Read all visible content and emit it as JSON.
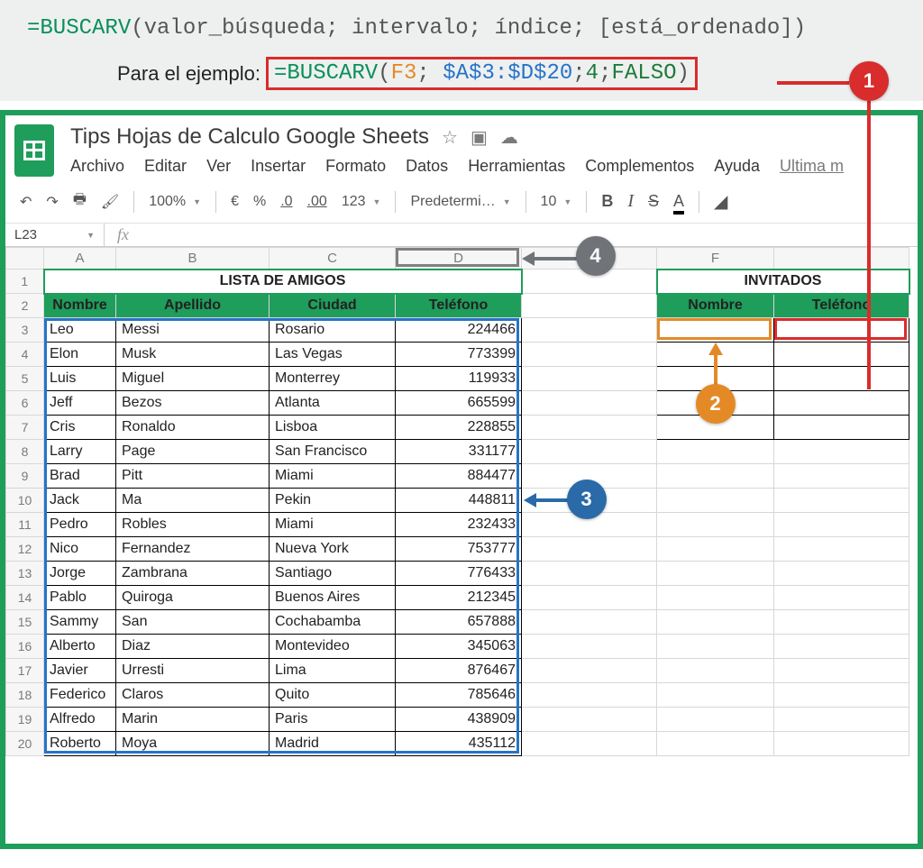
{
  "formula": {
    "syntax_func": "=BUSCARV",
    "syntax_args": "(valor_búsqueda; intervalo; índice; [está_ordenado])",
    "example_label": "Para el ejemplo:",
    "ex_func": "=BUSCARV",
    "ex_open": "(",
    "ex_ref": "F3",
    "ex_sep": ";",
    "ex_range": " $A$3:$D$20",
    "ex_idx": "4",
    "ex_bool": "FALSO",
    "ex_close": ")"
  },
  "doc": {
    "title": "Tips Hojas de Calculo Google Sheets",
    "last_mod": "Ultima m"
  },
  "menus": [
    "Archivo",
    "Editar",
    "Ver",
    "Insertar",
    "Formato",
    "Datos",
    "Herramientas",
    "Complementos",
    "Ayuda"
  ],
  "toolbar": {
    "zoom": "100%",
    "currency": "€",
    "percent": "%",
    "dec_dec": ".0",
    "inc_dec": ".00",
    "fmt123": "123",
    "font": "Predetermi…",
    "fontsize": "10",
    "bold": "B",
    "italic": "I",
    "strike": "S",
    "textcolor": "A"
  },
  "namebox": "L23",
  "colHeaders": [
    "A",
    "B",
    "C",
    "D",
    "",
    "F",
    ""
  ],
  "table1": {
    "title": "LISTA DE AMIGOS",
    "headers": [
      "Nombre",
      "Apellido",
      "Ciudad",
      "Teléfono"
    ],
    "rows": [
      [
        "Leo",
        "Messi",
        "Rosario",
        "224466"
      ],
      [
        "Elon",
        "Musk",
        "Las Vegas",
        "773399"
      ],
      [
        "Luis",
        "Miguel",
        "Monterrey",
        "119933"
      ],
      [
        "Jeff",
        "Bezos",
        "Atlanta",
        "665599"
      ],
      [
        "Cris",
        "Ronaldo",
        "Lisboa",
        "228855"
      ],
      [
        "Larry",
        "Page",
        "San Francisco",
        "331177"
      ],
      [
        "Brad",
        "Pitt",
        "Miami",
        "884477"
      ],
      [
        "Jack",
        "Ma",
        "Pekin",
        "448811"
      ],
      [
        "Pedro",
        "Robles",
        "Miami",
        "232433"
      ],
      [
        "Nico",
        "Fernandez",
        "Nueva York",
        "753777"
      ],
      [
        "Jorge",
        "Zambrana",
        "Santiago",
        "776433"
      ],
      [
        "Pablo",
        "Quiroga",
        "Buenos Aires",
        "212345"
      ],
      [
        "Sammy",
        "San",
        "Cochabamba",
        "657888"
      ],
      [
        "Alberto",
        "Diaz",
        "Montevideo",
        "345063"
      ],
      [
        "Javier",
        "Urresti",
        "Lima",
        "876467"
      ],
      [
        "Federico",
        "Claros",
        "Quito",
        "785646"
      ],
      [
        "Alfredo",
        "Marin",
        "Paris",
        "438909"
      ],
      [
        "Roberto",
        "Moya",
        "Madrid",
        "435112"
      ]
    ]
  },
  "table2": {
    "title": "INVITADOS",
    "headers": [
      "Nombre",
      "Teléfono"
    ]
  },
  "callouts": {
    "c1": "1",
    "c2": "2",
    "c3": "3",
    "c4": "4"
  }
}
